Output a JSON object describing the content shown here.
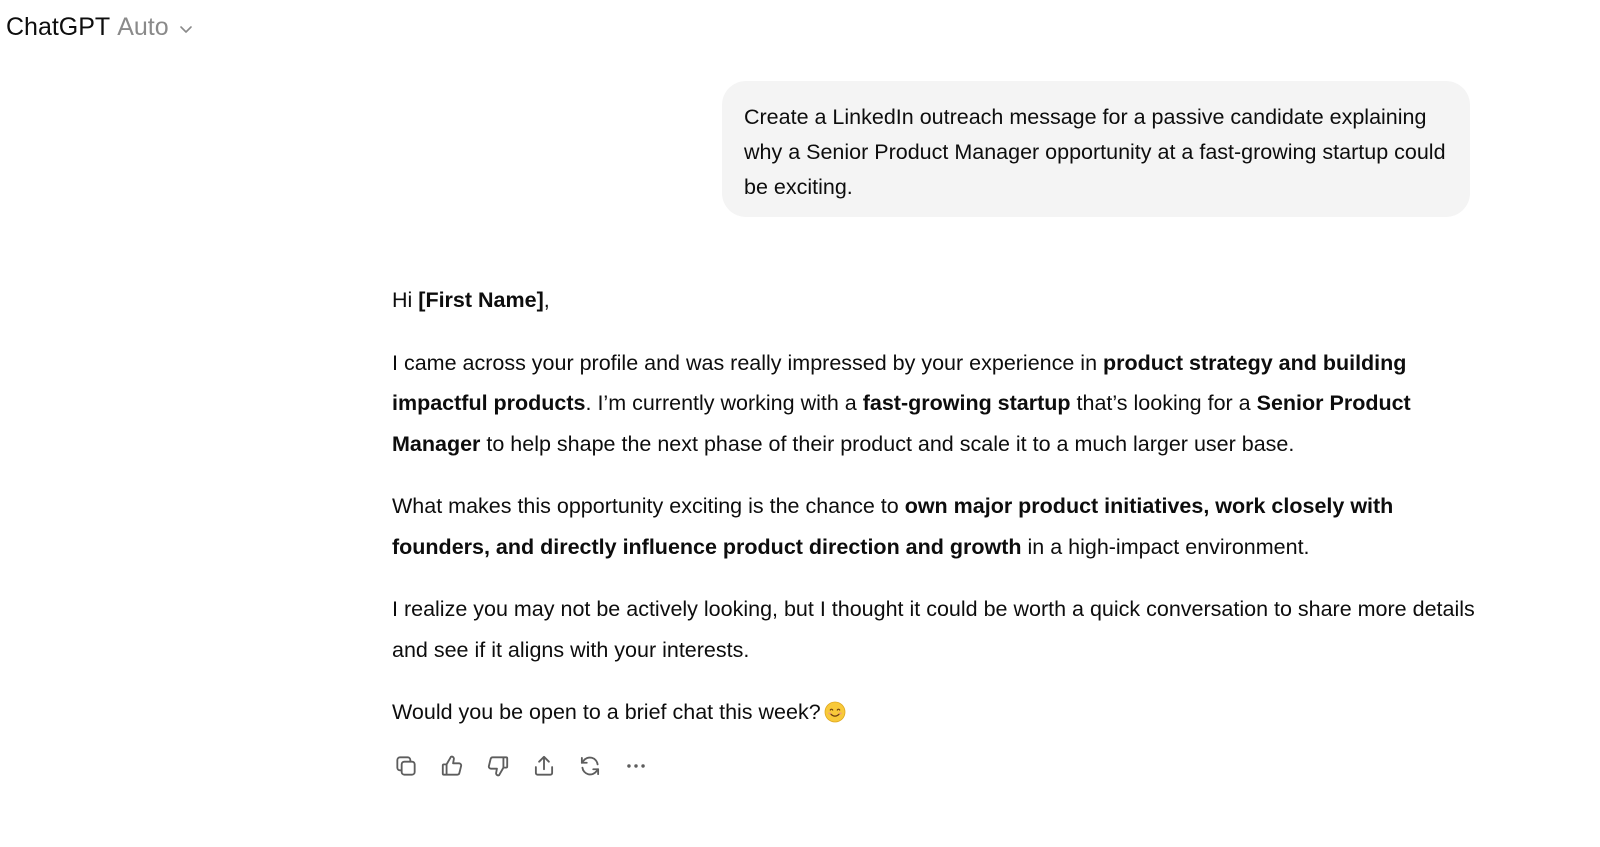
{
  "header": {
    "model_name": "ChatGPT",
    "model_mode": "Auto",
    "dropdown_icon": "chevron-down-icon"
  },
  "user_message": {
    "text": "Create a LinkedIn outreach message for a passive candidate explaining why a Senior Product Manager opportunity at a fast-growing startup could be exciting."
  },
  "assistant_message": {
    "greeting": {
      "pre": "Hi ",
      "bold": "[First Name]",
      "post": ","
    },
    "paragraph1": {
      "t1": "I came across your profile and was really impressed by your experience in ",
      "b1": "product strategy and building impactful products",
      "t2": ". I’m currently working with a ",
      "b2": "fast-growing startup",
      "t3": " that’s looking for a ",
      "b3": "Senior Product Manager",
      "t4": " to help shape the next phase of their product and scale it to a much larger user base."
    },
    "paragraph2": {
      "t1": "What makes this opportunity exciting is the chance to ",
      "b1": "own major product initiatives, work closely with founders, and directly influence product direction and growth",
      "t2": " in a high-impact environment."
    },
    "paragraph3": {
      "text": "I realize you may not be actively looking, but I thought it could be worth a quick conversation to share more details and see if it aligns with your interests."
    },
    "closing": {
      "text": "Would you be open to a brief chat this week?",
      "emoji_icon": "smiling-face-emoji-icon"
    }
  },
  "actions": [
    {
      "name": "copy-icon"
    },
    {
      "name": "thumbs-up-icon"
    },
    {
      "name": "thumbs-down-icon"
    },
    {
      "name": "share-icon"
    },
    {
      "name": "regenerate-icon"
    },
    {
      "name": "more-options-icon"
    }
  ],
  "colors": {
    "text": "#0d0d0d",
    "muted": "#8a8a8a",
    "bubble_bg": "#f4f4f4",
    "icon": "#5d5d5d"
  }
}
